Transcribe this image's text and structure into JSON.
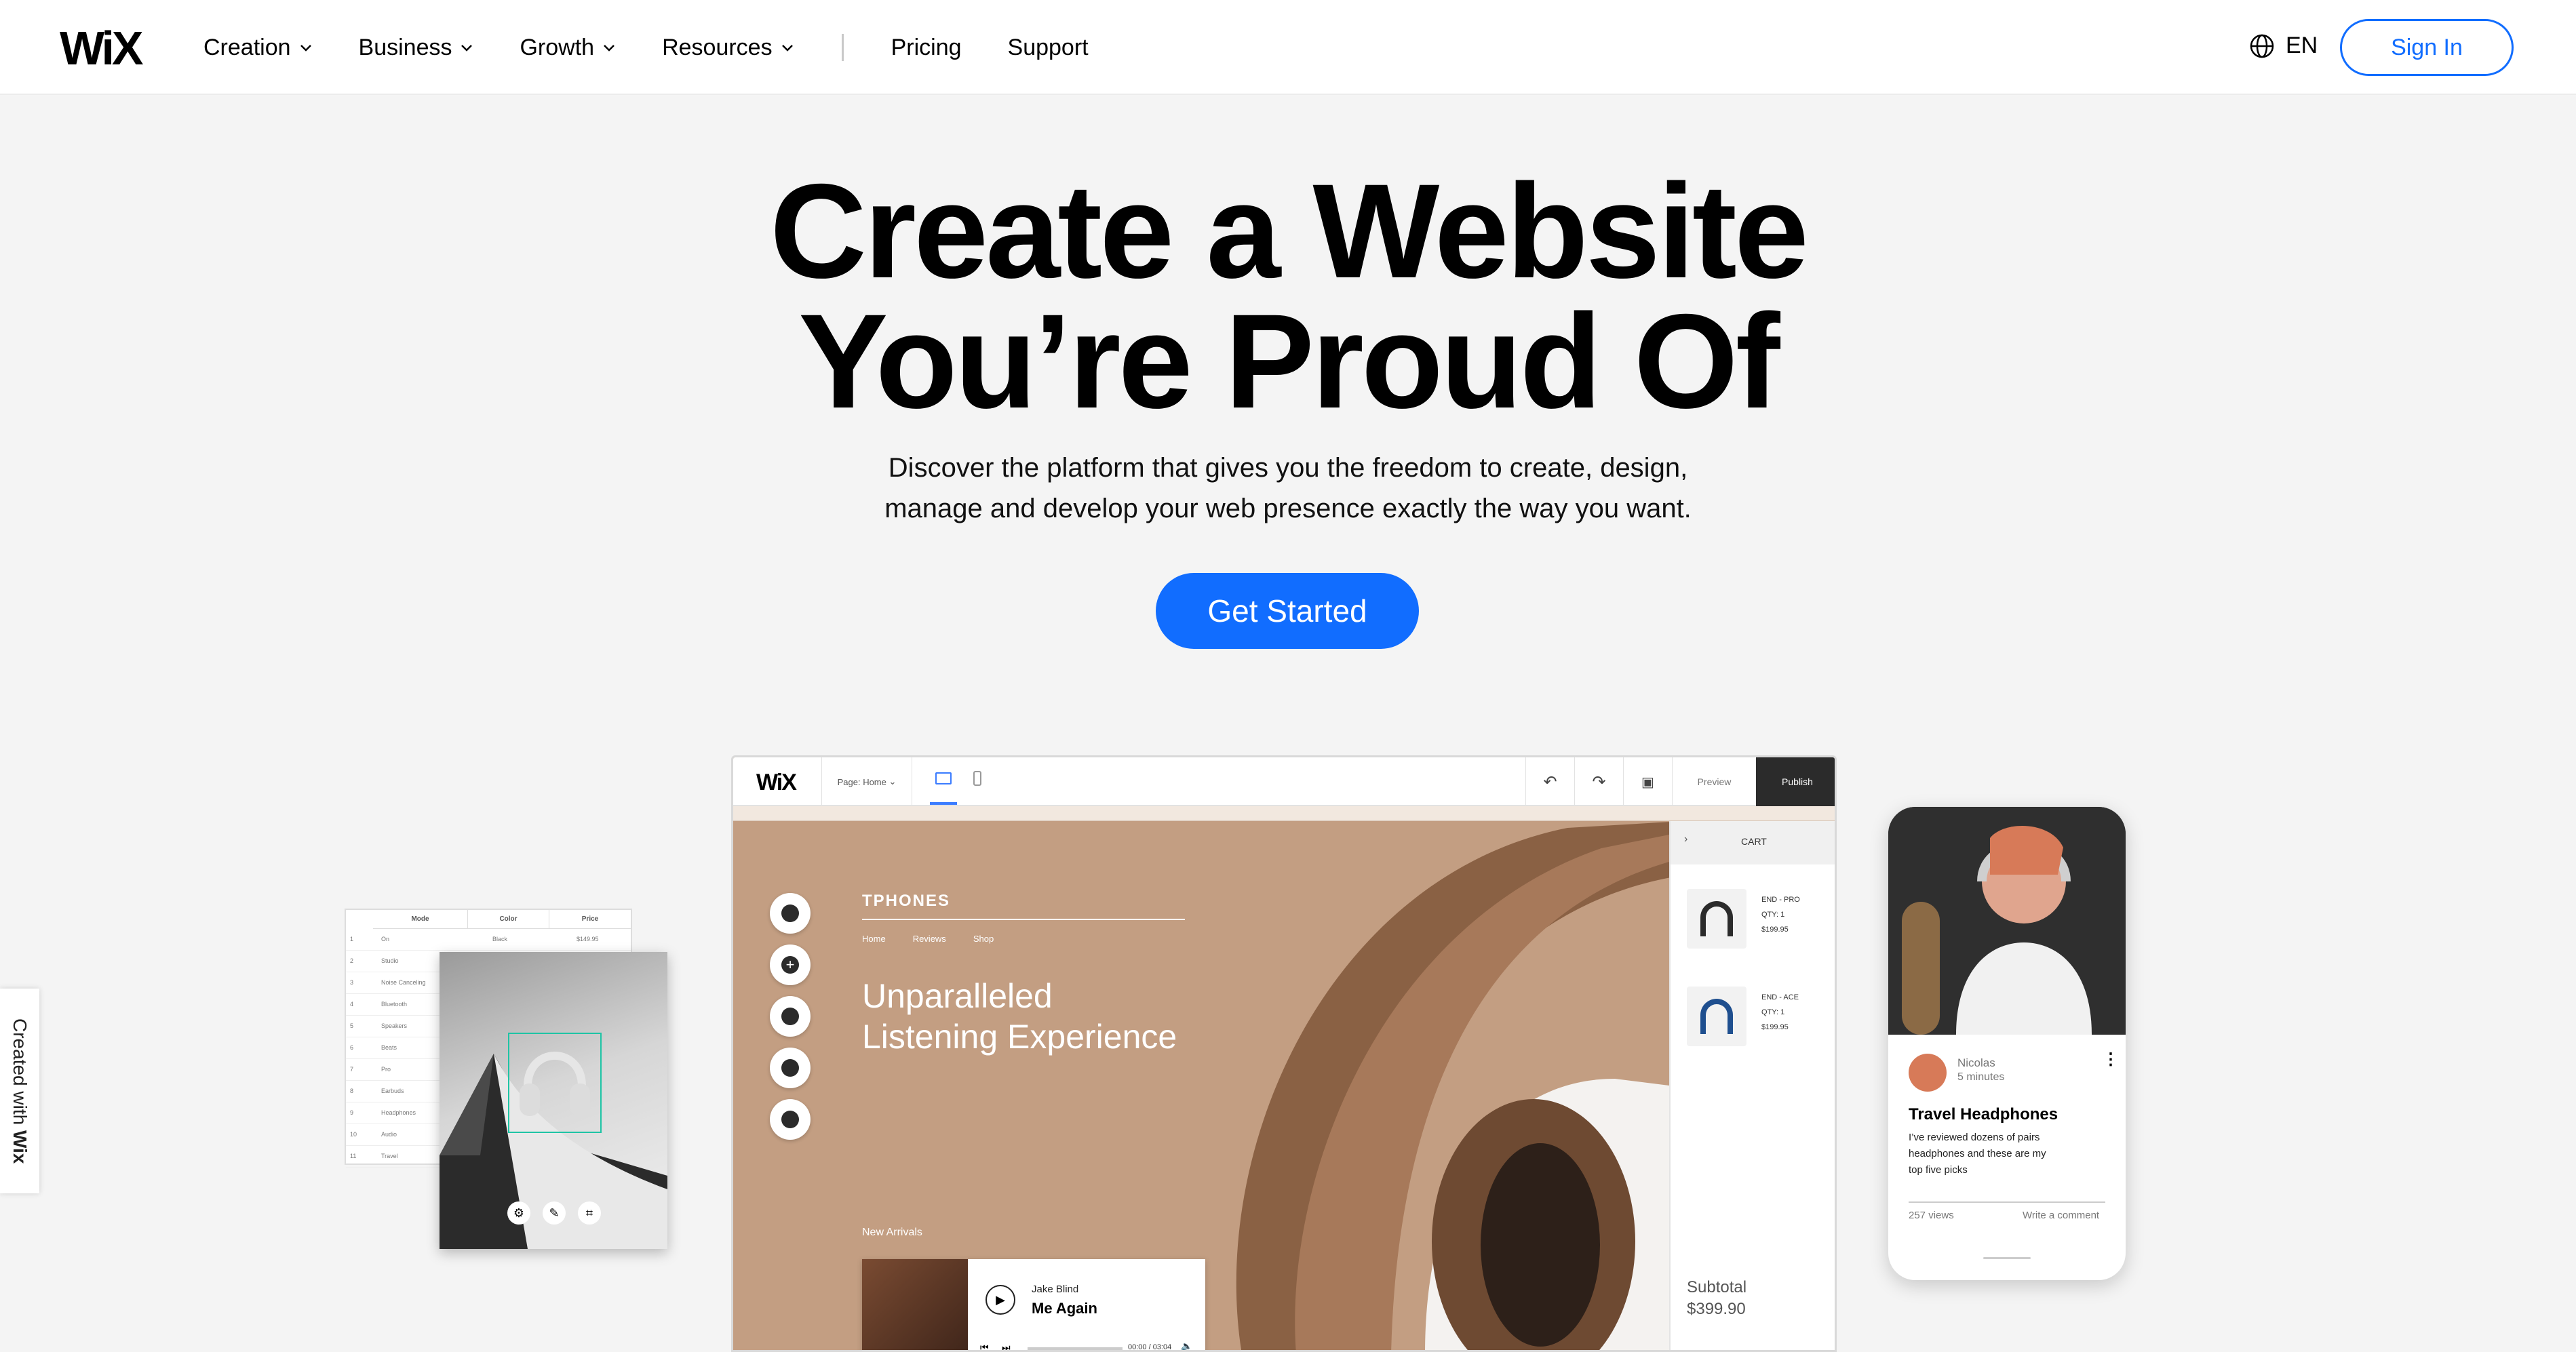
{
  "header": {
    "logo": "WiX",
    "nav": [
      {
        "label": "Creation",
        "dropdown": true
      },
      {
        "label": "Business",
        "dropdown": true
      },
      {
        "label": "Growth",
        "dropdown": true
      },
      {
        "label": "Resources",
        "dropdown": true
      }
    ],
    "nav_links": [
      "Pricing",
      "Support"
    ],
    "language": "EN",
    "sign_in": "Sign In"
  },
  "hero": {
    "title_line1": "Create a Website",
    "title_line2": "You’re Proud Of",
    "subtitle_line1": "Discover the platform that gives you the freedom to create, design,",
    "subtitle_line2": "manage and develop your web presence exactly the way you want.",
    "cta": "Get Started"
  },
  "badge": {
    "prefix": "Created with",
    "brand": "Wix"
  },
  "sheet": {
    "headers": [
      "Mode",
      "Color",
      "Price"
    ],
    "rows": [
      {
        "n": "1",
        "mode": "On",
        "color": "Black",
        "price": "$149.95"
      },
      {
        "n": "2",
        "mode": "Studio"
      },
      {
        "n": "3",
        "mode": "Noise Canceling"
      },
      {
        "n": "4",
        "mode": "Bluetooth"
      },
      {
        "n": "5",
        "mode": "Speakers"
      },
      {
        "n": "6",
        "mode": "Beats"
      },
      {
        "n": "7",
        "mode": "Pro"
      },
      {
        "n": "8",
        "mode": "Earbuds"
      },
      {
        "n": "9",
        "mode": "Headphones"
      },
      {
        "n": "10",
        "mode": "Audio"
      },
      {
        "n": "11",
        "mode": "Travel"
      }
    ]
  },
  "editor": {
    "logo": "WiX",
    "page_select": "Page: Home",
    "preview": "Preview",
    "publish": "Publish",
    "site": {
      "brand": "TPHONES",
      "menu": [
        "Home",
        "Reviews",
        "Shop"
      ],
      "headline_1": "Unparalleled",
      "headline_2": "Listening Experience",
      "new_arrivals": "New Arrivals",
      "player": {
        "artist": "Jake Blind",
        "track": "Me Again",
        "time": "00:00 / 03:04",
        "progress": 0
      }
    },
    "cart": {
      "title": "CART",
      "items": [
        {
          "name": "END - PRO",
          "qty": "QTY: 1",
          "price": "$199.95"
        },
        {
          "name": "END - ACE",
          "qty": "QTY: 1",
          "price": "$199.95"
        }
      ],
      "subtotal_label": "Subtotal",
      "subtotal_value": "$399.90"
    }
  },
  "phone": {
    "author": "Nicolas",
    "time": "5 minutes",
    "post_title": "Travel Headphones",
    "excerpt_1": "I’ve reviewed dozens of pairs",
    "excerpt_2": "headphones and these are my",
    "excerpt_3": "top five picks",
    "views": "257 views",
    "comment": "Write a comment"
  },
  "colors": {
    "accent": "#116dff",
    "site_bg": "#c39e82",
    "page_bg": "#f4f4f4"
  }
}
